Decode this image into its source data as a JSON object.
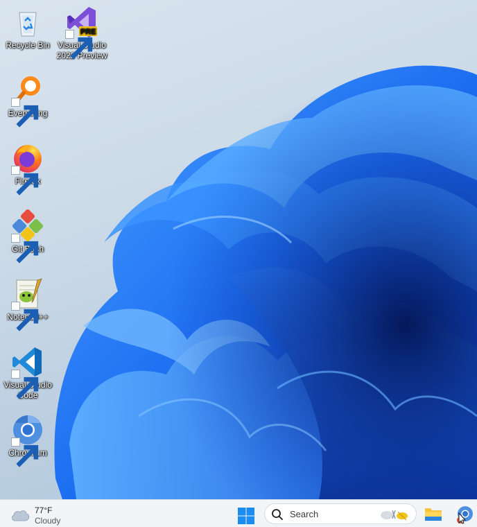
{
  "desktop": {
    "icons": [
      {
        "label": "Recycle Bin",
        "icon": "recycle-bin-icon"
      },
      {
        "label": "Visual Studio 2022 Preview",
        "icon": "visual-studio-preview-icon",
        "badge": "PRE"
      },
      {
        "label": "Everything",
        "icon": "everything-search-icon"
      },
      {
        "label": "Firefox",
        "icon": "firefox-icon"
      },
      {
        "label": "Git Bash",
        "icon": "git-bash-icon"
      },
      {
        "label": "Notepad++",
        "icon": "notepad-plus-plus-icon"
      },
      {
        "label": "Visual Studio Code",
        "icon": "vscode-icon"
      },
      {
        "label": "Chromium",
        "icon": "chromium-icon"
      }
    ]
  },
  "taskbar": {
    "weather": {
      "temperature": "77°F",
      "condition": "Cloudy",
      "icon": "cloud-icon"
    },
    "search": {
      "placeholder": "Search",
      "icon": "search-icon"
    },
    "start_icon": "windows-logo-icon",
    "pinned": [
      {
        "name": "File Explorer",
        "icon": "folder-icon"
      },
      {
        "name": "Chromium",
        "icon": "chromium-icon"
      }
    ]
  },
  "colors": {
    "wallpaper_blue": "#1a6ff0",
    "taskbar_bg": "#f2f4f7",
    "accent": "#0078d4"
  }
}
